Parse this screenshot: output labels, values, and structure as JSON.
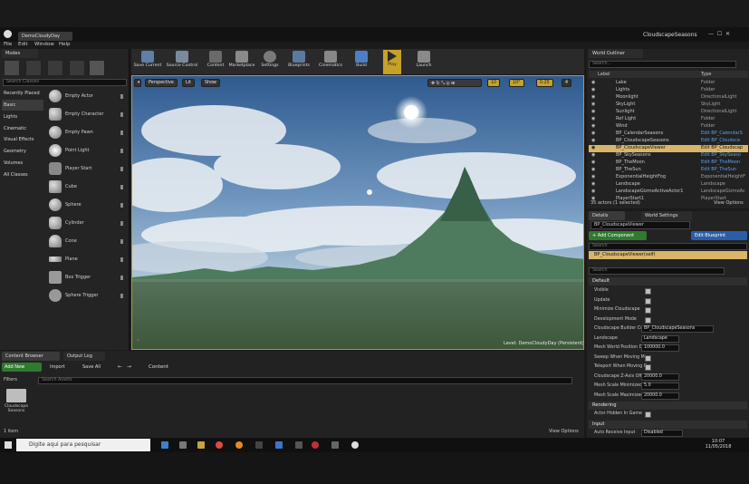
{
  "window": {
    "title": "CloudscapeSeasons",
    "project_tab": "DemoCloudyDay"
  },
  "menu": [
    "File",
    "Edit",
    "Window",
    "Help"
  ],
  "modes": {
    "tab": "Modes",
    "search_placeholder": "Search Classes",
    "categories": [
      "Recently Placed",
      "Basic",
      "Lights",
      "Cinematic",
      "Visual Effects",
      "Geometry",
      "Volumes",
      "All Classes"
    ],
    "items": [
      "Empty Actor",
      "Empty Character",
      "Empty Pawn",
      "Point Light",
      "Player Start",
      "Cube",
      "Sphere",
      "Cylinder",
      "Cone",
      "Plane",
      "Box Trigger",
      "Sphere Trigger"
    ]
  },
  "toolbar": {
    "buttons": [
      "Save Current",
      "Source Control",
      "Content",
      "Marketplace",
      "Settings",
      "Blueprints",
      "Cinematics",
      "Build",
      "Play",
      "Launch"
    ]
  },
  "viewport": {
    "perspective": "Perspective",
    "lit": "Lit",
    "show": "Show",
    "snap_values": [
      "10",
      "10°",
      "0.25",
      "4"
    ],
    "level_text": "Level: DemoCloudyDay (Persistent)"
  },
  "outliner": {
    "tab": "World Outliner",
    "search_placeholder": "Search...",
    "col_label": "Label",
    "col_type": "Type",
    "rows": [
      {
        "label": "Lake",
        "type": "Folder",
        "hl": false,
        "link": false
      },
      {
        "label": "Lights",
        "type": "Folder",
        "hl": false,
        "link": false
      },
      {
        "label": "Moonlight",
        "type": "DirectionalLight",
        "hl": false,
        "link": false
      },
      {
        "label": "SkyLight",
        "type": "SkyLight",
        "hl": false,
        "link": false
      },
      {
        "label": "Sunlight",
        "type": "DirectionalLight",
        "hl": false,
        "link": false
      },
      {
        "label": "Ref Light",
        "type": "Folder",
        "hl": false,
        "link": false
      },
      {
        "label": "Wind",
        "type": "Folder",
        "hl": false,
        "link": false
      },
      {
        "label": "BP_CalendarSeasons",
        "type": "Edit BP_CalendarS",
        "hl": false,
        "link": true
      },
      {
        "label": "BP_CloudscapeSeasons",
        "type": "Edit BP_Cloudsca",
        "hl": false,
        "link": true
      },
      {
        "label": "BP_CloudscapeViewer",
        "type": "Edit BP_Cloudscap",
        "hl": true,
        "link": true
      },
      {
        "label": "BP_SkySeasons",
        "type": "Edit BP_SkySeaso",
        "hl": false,
        "link": true
      },
      {
        "label": "BP_TheMoon",
        "type": "Edit BP_TheMoon",
        "hl": false,
        "link": true
      },
      {
        "label": "BP_TheSun",
        "type": "Edit BP_TheSun",
        "hl": false,
        "link": true
      },
      {
        "label": "ExponentialHeightFog",
        "type": "ExponentialHeightF",
        "hl": false,
        "link": false
      },
      {
        "label": "Landscape",
        "type": "Landscape",
        "hl": false,
        "link": false
      },
      {
        "label": "LandscapeGizmoActiveActor1",
        "type": "LandscapeGizmoAc",
        "hl": false,
        "link": false
      },
      {
        "label": "PlayerStart1",
        "type": "PlayerStart",
        "hl": false,
        "link": false
      }
    ],
    "count": "35 actors (1 selected)",
    "view_options": "View Options"
  },
  "details": {
    "tab_details": "Details",
    "tab_world": "World Settings",
    "actor_name": "BP_CloudscapeViewer",
    "add_component": "+ Add Component",
    "edit_blueprint": "Edit Blueprint",
    "component_search": "Search",
    "component_self": "BP_CloudscapeViewer(self)",
    "prop_search": "Search",
    "section_default": "Default",
    "section_rendering": "Rendering",
    "section_input": "Input",
    "props": [
      {
        "label": "Visible",
        "kind": "check"
      },
      {
        "label": "Update",
        "kind": "check"
      },
      {
        "label": "Minimize Cloudscape",
        "kind": "check"
      },
      {
        "label": "Development Mode",
        "kind": "check"
      },
      {
        "label": "Cloudscape Builder Com",
        "kind": "field",
        "value": "BP_CloudscapeSeasons"
      },
      {
        "label": "Landscape",
        "kind": "field",
        "value": "Landscape"
      },
      {
        "label": "Mesh World Position Dir",
        "kind": "field",
        "value": "100000.0"
      },
      {
        "label": "Sweep When Moving Ma",
        "kind": "check"
      },
      {
        "label": "Teleport When Moving N",
        "kind": "check"
      },
      {
        "label": "Cloudscape Z-Axis Offset",
        "kind": "field",
        "value": "20000.0"
      },
      {
        "label": "Mesh Scale Minimized",
        "kind": "field",
        "value": "5.0"
      },
      {
        "label": "Mesh Scale Maximized",
        "kind": "field",
        "value": "20000.0"
      }
    ],
    "actor_hidden": "Actor Hidden In Game",
    "auto_receive": "Auto Receive Input",
    "auto_receive_value": "Disabled"
  },
  "content_browser": {
    "tab": "Content Browser",
    "tab2": "Output Log",
    "add_new": "Add New",
    "import": "Import",
    "save_all": "Save All",
    "path": "Content",
    "filters": "Filters",
    "search_placeholder": "Search Assets",
    "folder": "Cloudscape Seasons",
    "count": "1 item",
    "view_options": "View Options"
  },
  "taskbar": {
    "search": "Digite aqui para pesquisar",
    "time": "10:07",
    "date": "11/05/2018"
  }
}
